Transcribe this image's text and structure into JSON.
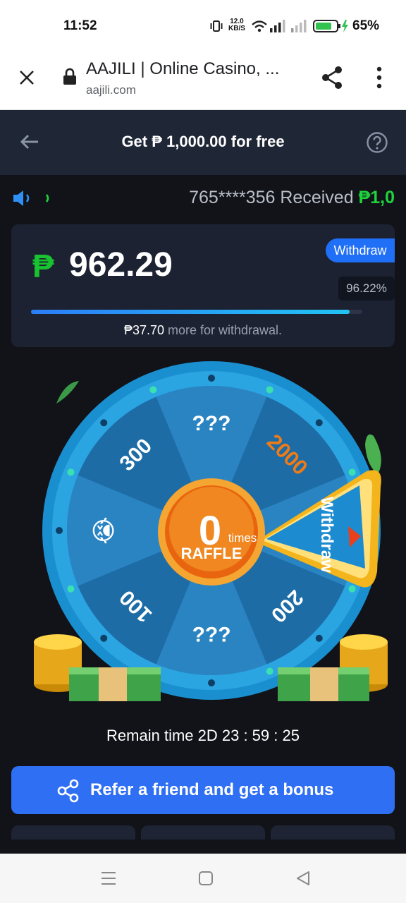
{
  "status_bar": {
    "time": "11:52",
    "net_speed_top": "12.0",
    "net_speed_bottom": "KB/S",
    "battery": "65%"
  },
  "browser": {
    "title": "AAJILI | Online Casino, ...",
    "url": "aajili.com"
  },
  "header": {
    "title": "Get ₱ 1,000.00 for free"
  },
  "ticker": {
    "prefix": "765****356 Received ",
    "amount": "₱1,0"
  },
  "balance_card": {
    "currency": "₱",
    "balance": "962.29",
    "withdraw_label": "Withdraw",
    "percent": "96.22%",
    "progress": 0.9622,
    "note_amount": "₱37.70",
    "note_text": " more for withdrawal."
  },
  "wheel": {
    "segments": [
      "???",
      "2000",
      "Withdraw",
      "200",
      "¿¿¿",
      "100",
      "😭",
      "300"
    ],
    "center_count": "0",
    "center_times": "times",
    "center_label": "RAFFLE"
  },
  "remain_time": "Remain time 2D 23 : 59 : 25",
  "refer_button": "Refer a friend and get a bonus",
  "colors": {
    "accent_blue": "#2f6ff3",
    "green": "#1fd33d",
    "wheel_blue": "#2a95d6",
    "orange": "#f17a16"
  }
}
